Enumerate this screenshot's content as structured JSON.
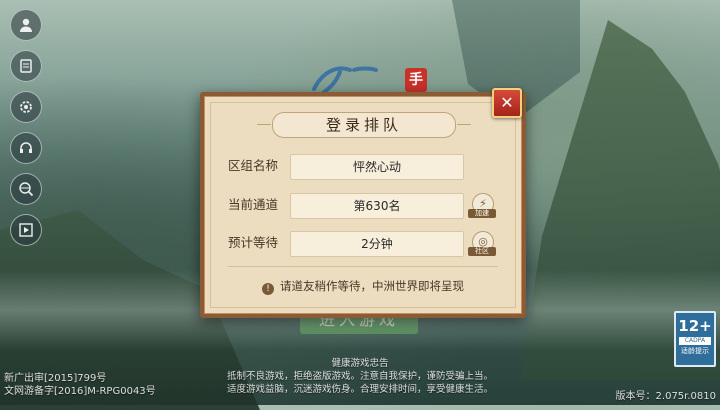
{
  "sidebar": {
    "items": [
      {
        "icon": "user-icon"
      },
      {
        "icon": "notice-icon"
      },
      {
        "icon": "settings-icon"
      },
      {
        "icon": "headset-icon"
      },
      {
        "icon": "globe-search-icon"
      },
      {
        "icon": "video-icon"
      }
    ]
  },
  "logo": {
    "seal": "手"
  },
  "enter_button": {
    "label": "进入游戏"
  },
  "dialog": {
    "title": "登录排队",
    "close_label": "✕",
    "rows": [
      {
        "label": "区组名称",
        "value": "怦然心动"
      },
      {
        "label": "当前通道",
        "value": "第630名",
        "icon": "lightning-icon",
        "icon_caption": "加速"
      },
      {
        "label": "预计等待",
        "value": "2分钟",
        "icon": "community-icon",
        "icon_caption": "社区"
      }
    ],
    "notice": "请道友稍作等待，中洲世界即将呈现"
  },
  "cadpa": {
    "age": "12+",
    "org": "CADPA",
    "tip": "适龄提示"
  },
  "footer": {
    "license_line1": "新广出审[2015]799号",
    "license_line2": "文网游备字[2016]M-RPG0043号",
    "advice_title": "健康游戏忠告",
    "advice_line1": "抵制不良游戏，拒绝盗版游戏。注意自我保护，谨防受骗上当。",
    "advice_line2": "适度游戏益脑，沉迷游戏伤身。合理安排时间，享受健康生活。",
    "version": "版本号：2.075r.0810"
  },
  "colors": {
    "dialog_bg": "#ecdcc0",
    "dialog_border": "#8c5a34",
    "close_red": "#c8322a",
    "badge_blue": "#2f6e9a"
  }
}
